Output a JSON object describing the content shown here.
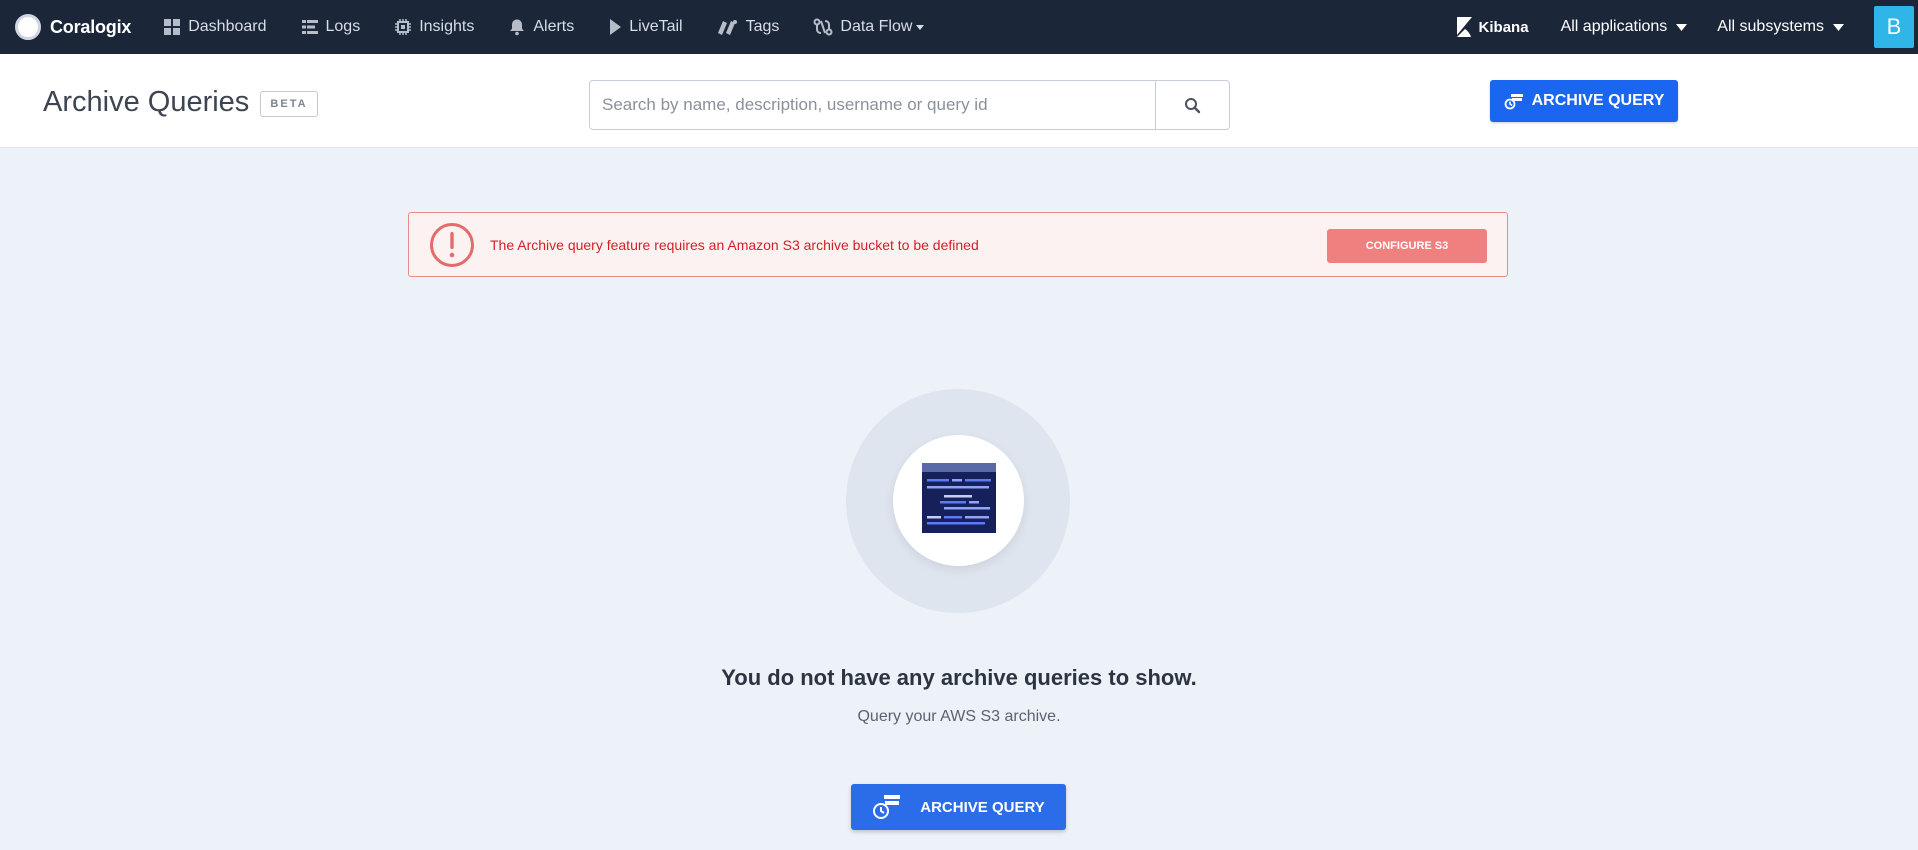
{
  "topbar": {
    "brand": "Coralogix",
    "nav": [
      {
        "label": "Dashboard",
        "icon": "dashboard-grid-icon"
      },
      {
        "label": "Logs",
        "icon": "logs-list-icon"
      },
      {
        "label": "Insights",
        "icon": "insights-chip-icon"
      },
      {
        "label": "Alerts",
        "icon": "bell-icon"
      },
      {
        "label": "LiveTail",
        "icon": "play-icon"
      },
      {
        "label": "Tags",
        "icon": "tags-icon"
      },
      {
        "label": "Data Flow",
        "icon": "data-flow-icon"
      }
    ],
    "kibana": "Kibana",
    "applications": "All applications",
    "subsystems": "All subsystems",
    "avatar_letter": "B"
  },
  "header": {
    "title": "Archive Queries",
    "badge": "BETA",
    "search_placeholder": "Search by name, description, username or query id",
    "archive_button": "ARCHIVE QUERY"
  },
  "alert": {
    "message": "The Archive query feature requires an Amazon S3 archive bucket to be defined",
    "button": "CONFIGURE S3",
    "icon": "exclamation-circle-icon",
    "color": "#d4202a"
  },
  "empty_state": {
    "title": "You do not have any archive queries to show.",
    "subtitle": "Query your AWS S3 archive.",
    "button": "ARCHIVE QUERY"
  },
  "colors": {
    "topbar": "#1c2639",
    "primary": "#1a66f0",
    "background": "#edf2f9",
    "avatar": "#2fb5e8"
  }
}
